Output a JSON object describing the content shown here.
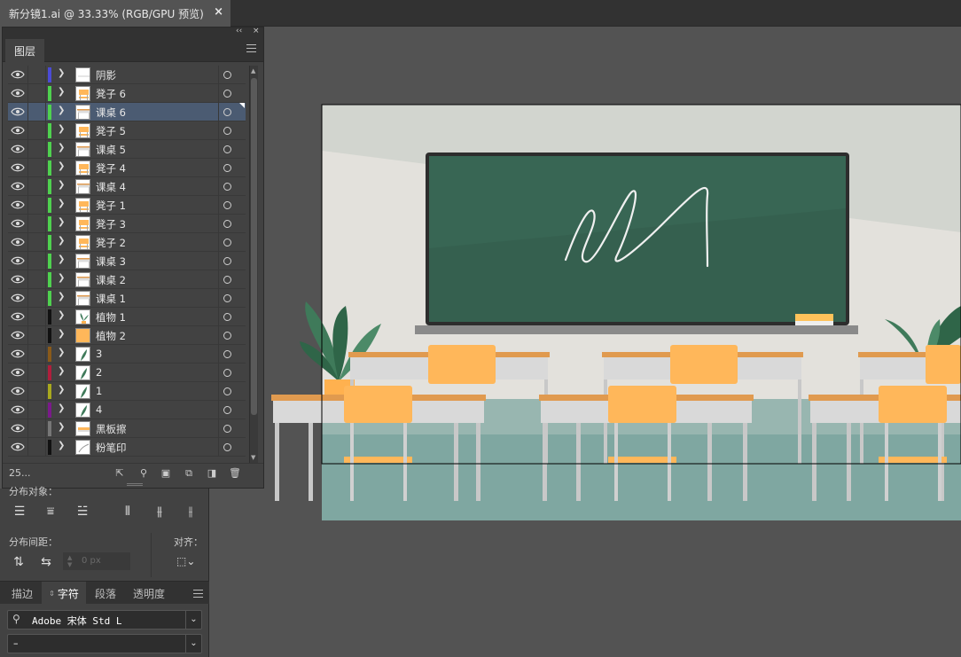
{
  "document_tab": {
    "title": "新分镜1.ai @ 33.33% (RGB/GPU 预览)",
    "close_glyph": "×"
  },
  "layers_panel": {
    "tab_label": "图层",
    "collapse_glyph": "‹‹",
    "close_glyph": "×",
    "layer_count": "25...",
    "layers": [
      {
        "name": "阴影",
        "color": "#4b4bd6",
        "thumb": "shadow",
        "selected": false
      },
      {
        "name": "凳子 6",
        "color": "#4fd14f",
        "thumb": "stool",
        "selected": false
      },
      {
        "name": "课桌 6",
        "color": "#4fd14f",
        "thumb": "desk",
        "selected": true
      },
      {
        "name": "凳子 5",
        "color": "#4fd14f",
        "thumb": "stool",
        "selected": false
      },
      {
        "name": "课桌 5",
        "color": "#4fd14f",
        "thumb": "desk",
        "selected": false
      },
      {
        "name": "凳子 4",
        "color": "#4fd14f",
        "thumb": "stool",
        "selected": false
      },
      {
        "name": "课桌 4",
        "color": "#4fd14f",
        "thumb": "desk",
        "selected": false
      },
      {
        "name": "凳子 1",
        "color": "#4fd14f",
        "thumb": "stool",
        "selected": false
      },
      {
        "name": "凳子 3",
        "color": "#4fd14f",
        "thumb": "stool",
        "selected": false
      },
      {
        "name": "凳子 2",
        "color": "#4fd14f",
        "thumb": "stool",
        "selected": false
      },
      {
        "name": "课桌 3",
        "color": "#4fd14f",
        "thumb": "desk",
        "selected": false
      },
      {
        "name": "课桌 2",
        "color": "#4fd14f",
        "thumb": "desk",
        "selected": false
      },
      {
        "name": "课桌 1",
        "color": "#4fd14f",
        "thumb": "desk",
        "selected": false
      },
      {
        "name": "植物 1",
        "color": "#111111",
        "thumb": "plant",
        "selected": false
      },
      {
        "name": "植物 2",
        "color": "#111111",
        "thumb": "orange",
        "selected": false
      },
      {
        "name": "3",
        "color": "#8a5a1a",
        "thumb": "leaf",
        "selected": false
      },
      {
        "name": "2",
        "color": "#b01e3c",
        "thumb": "leaf",
        "selected": false
      },
      {
        "name": "1",
        "color": "#a8a81e",
        "thumb": "leaf",
        "selected": false
      },
      {
        "name": "4",
        "color": "#7a1a8a",
        "thumb": "leaf",
        "selected": false
      },
      {
        "name": "黑板擦",
        "color": "#777777",
        "thumb": "eraser",
        "selected": false
      },
      {
        "name": "粉笔印",
        "color": "#111111",
        "thumb": "chalk",
        "selected": false
      }
    ]
  },
  "align_panel": {
    "partial_label": "分布对象：",
    "distribute_spacing_label": "分布间距：",
    "align_to_label": "对齐：",
    "spacing_value": "0 px"
  },
  "character_panel": {
    "tabs": [
      "描边",
      "字符",
      "段落",
      "透明度"
    ],
    "active_tab": "字符",
    "font_family": "Adobe 宋体 Std L",
    "font_style": "–"
  },
  "artwork": {
    "wall_color": "#e3e1dc",
    "board_color": "#35604f",
    "floor_color": "#7fa7a1",
    "chair_color": "#ffb75a",
    "desk_top_color": "#e09a4f"
  }
}
